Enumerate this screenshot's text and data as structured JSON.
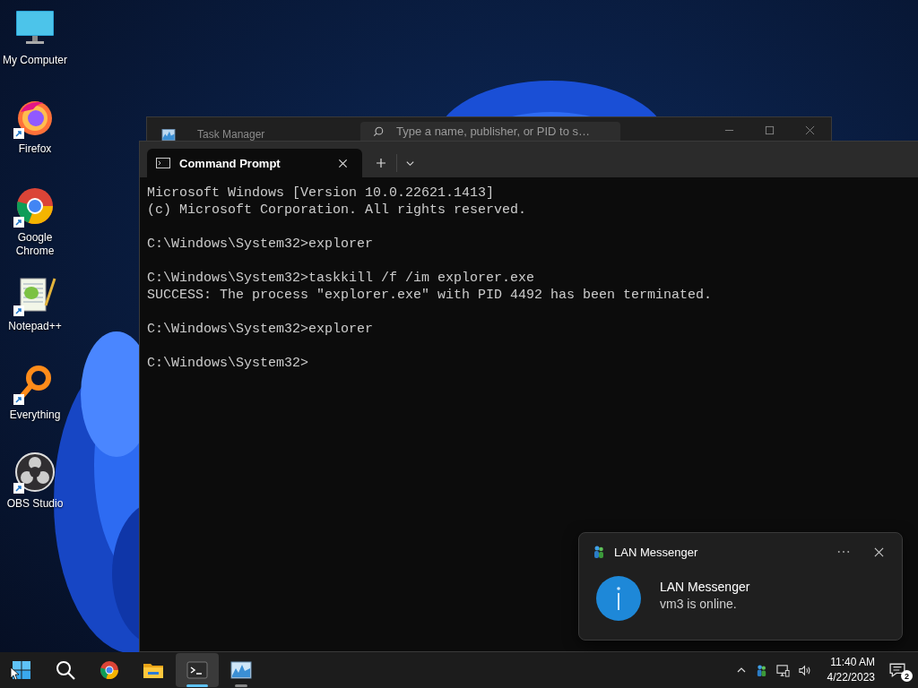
{
  "desktop_icons": [
    {
      "kind": "computer",
      "label": "My Computer",
      "shortcut": false
    },
    {
      "kind": "firefox",
      "label": "Firefox",
      "shortcut": true
    },
    {
      "kind": "chrome",
      "label": "Google Chrome",
      "shortcut": true
    },
    {
      "kind": "notepad",
      "label": "Notepad++",
      "shortcut": true
    },
    {
      "kind": "everything",
      "label": "Everything",
      "shortcut": true
    },
    {
      "kind": "obs",
      "label": "OBS Studio",
      "shortcut": true
    }
  ],
  "task_manager": {
    "title": "Task Manager",
    "search": {
      "placeholder": "Type a name, publisher, or PID to s…"
    }
  },
  "terminal": {
    "tabs": [
      {
        "title": "Command Prompt",
        "selected": true
      }
    ],
    "blocks": [
      [
        "Microsoft Windows [Version 10.0.22621.1413]",
        "(c) Microsoft Corporation. All rights reserved."
      ],
      [
        "C:\\Windows\\System32>explorer"
      ],
      [
        "C:\\Windows\\System32>taskkill /f /im explorer.exe",
        "SUCCESS: The process \"explorer.exe\" with PID 4492 has been terminated."
      ],
      [
        "C:\\Windows\\System32>explorer"
      ],
      [
        "C:\\Windows\\System32>"
      ]
    ]
  },
  "notification": {
    "app": "LAN Messenger",
    "title": "LAN Messenger",
    "message": "vm3 is online."
  },
  "taskbar": {
    "apps": [
      {
        "kind": "start",
        "running": false,
        "active": false
      },
      {
        "kind": "search",
        "running": false,
        "active": false
      },
      {
        "kind": "chrome",
        "running": false,
        "active": false
      },
      {
        "kind": "explorer",
        "running": false,
        "active": false
      },
      {
        "kind": "terminal",
        "running": true,
        "active": true
      },
      {
        "kind": "taskmanager",
        "running": true,
        "active": false
      }
    ],
    "time": "11:40 AM",
    "date": "4/22/2023",
    "notification_count": "2"
  }
}
